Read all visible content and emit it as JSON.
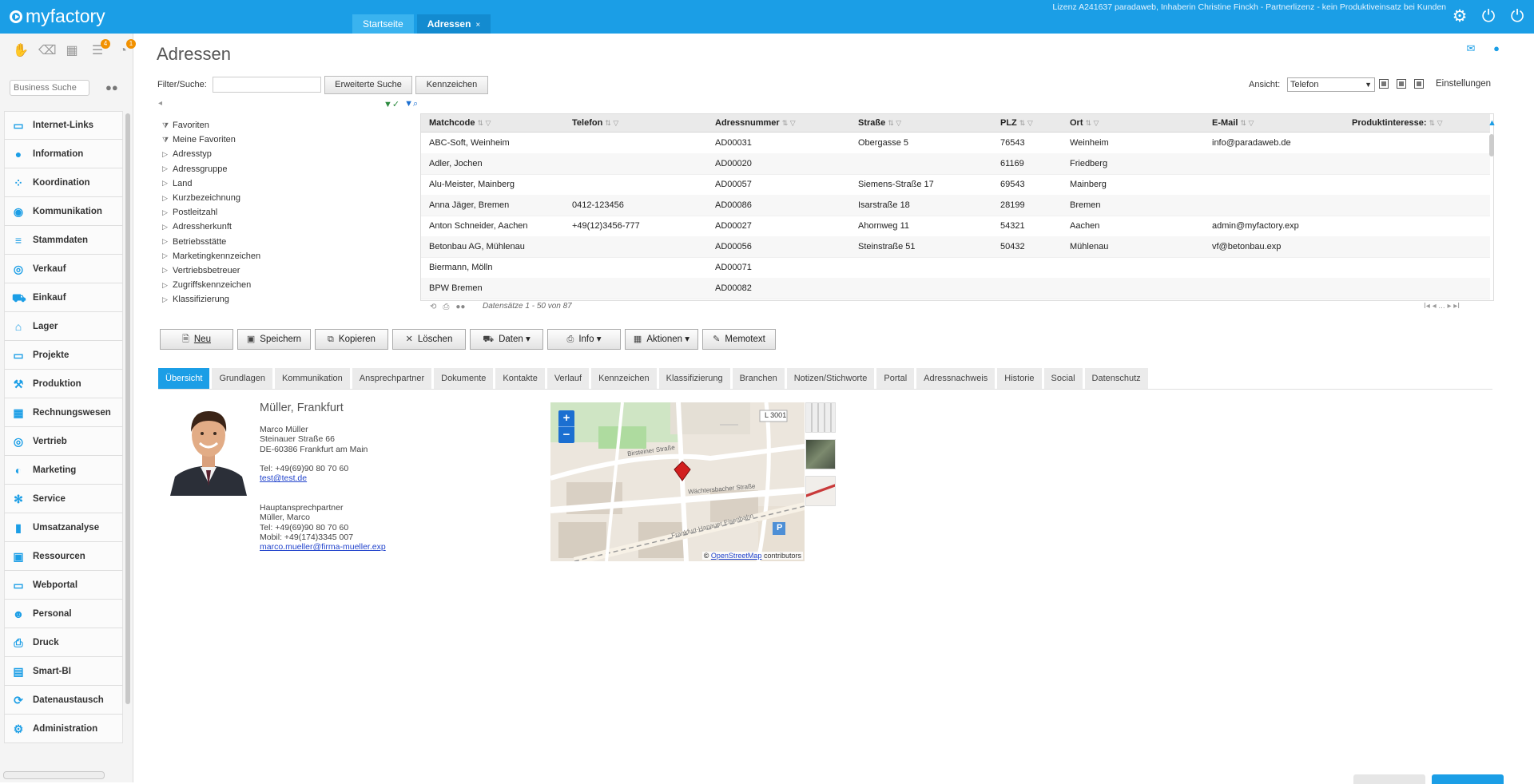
{
  "app": {
    "logo_text": "myfactory",
    "license": "Lizenz A241637 paradaweb, Inhaberin Christine Finckh - Partnerlizenz - kein Produktiveinsatz bei Kunden",
    "tabs": [
      {
        "label": "Startseite"
      },
      {
        "label": "Adressen"
      }
    ],
    "active_tab_close": "×",
    "top_icons": [
      "gear-icon",
      "power-icon",
      "power-alt-icon"
    ]
  },
  "sidebar": {
    "search_placeholder": "Business Suche",
    "modules": [
      {
        "label": "Internet-Links",
        "icon": "globe-icon"
      },
      {
        "label": "Information",
        "icon": "info-icon"
      },
      {
        "label": "Koordination",
        "icon": "network-icon"
      },
      {
        "label": "Kommunikation",
        "icon": "chat-icon"
      },
      {
        "label": "Stammdaten",
        "icon": "database-icon"
      },
      {
        "label": "Verkauf",
        "icon": "coins-icon"
      },
      {
        "label": "Einkauf",
        "icon": "cart-icon"
      },
      {
        "label": "Lager",
        "icon": "warehouse-icon"
      },
      {
        "label": "Projekte",
        "icon": "presentation-icon"
      },
      {
        "label": "Produktion",
        "icon": "factory-icon"
      },
      {
        "label": "Rechnungswesen",
        "icon": "grid-icon"
      },
      {
        "label": "Vertrieb",
        "icon": "target-icon"
      },
      {
        "label": "Marketing",
        "icon": "megaphone-icon"
      },
      {
        "label": "Service",
        "icon": "wrench-icon"
      },
      {
        "label": "Umsatzanalyse",
        "icon": "bar-chart-icon"
      },
      {
        "label": "Ressourcen",
        "icon": "resources-icon"
      },
      {
        "label": "Webportal",
        "icon": "web-icon"
      },
      {
        "label": "Personal",
        "icon": "people-icon"
      },
      {
        "label": "Druck",
        "icon": "printer-icon"
      },
      {
        "label": "Smart-BI",
        "icon": "bi-icon"
      },
      {
        "label": "Datenaustausch",
        "icon": "exchange-icon"
      },
      {
        "label": "Administration",
        "icon": "admin-gear-icon"
      }
    ]
  },
  "main": {
    "title": "Adressen",
    "filter_label": "Filter/Suche:",
    "filter_value": "",
    "btn_extended_search": "Erweiterte Suche",
    "btn_marks": "Kennzeichen",
    "view_label": "Ansicht:",
    "view_value": "Telefon",
    "settings": "Einstellungen",
    "tree": [
      {
        "label": "Favoriten",
        "marker": "filter"
      },
      {
        "label": "Meine Favoriten",
        "marker": "filter"
      },
      {
        "label": "Adresstyp",
        "marker": "tri"
      },
      {
        "label": "Adressgruppe",
        "marker": "tri"
      },
      {
        "label": "Land",
        "marker": "tri"
      },
      {
        "label": "Kurzbezeichnung",
        "marker": "tri"
      },
      {
        "label": "Postleitzahl",
        "marker": "tri"
      },
      {
        "label": "Adressherkunft",
        "marker": "tri"
      },
      {
        "label": "Betriebsstätte",
        "marker": "tri"
      },
      {
        "label": "Marketingkennzeichen",
        "marker": "tri"
      },
      {
        "label": "Vertriebsbetreuer",
        "marker": "tri"
      },
      {
        "label": "Zugriffskennzeichen",
        "marker": "tri"
      },
      {
        "label": "Klassifizierung",
        "marker": "tri"
      }
    ],
    "grid": {
      "columns": [
        "Matchcode",
        "Telefon",
        "Adressnummer",
        "Straße",
        "PLZ",
        "Ort",
        "E-Mail",
        "Produktinteresse:"
      ],
      "rows": [
        [
          "ABC-Soft, Weinheim",
          "",
          "AD00031",
          "Obergasse 5",
          "76543",
          "Weinheim",
          "info@paradaweb.de",
          ""
        ],
        [
          "Adler, Jochen",
          "",
          "AD00020",
          "",
          "61169",
          "Friedberg",
          "",
          ""
        ],
        [
          "Alu-Meister, Mainberg",
          "",
          "AD00057",
          "Siemens-Straße 17",
          "69543",
          "Mainberg",
          "",
          ""
        ],
        [
          "Anna Jäger, Bremen",
          "0412-123456",
          "AD00086",
          "Isarstraße 18",
          "28199",
          "Bremen",
          "",
          ""
        ],
        [
          "Anton Schneider, Aachen",
          "+49(12)3456-777",
          "AD00027",
          "Ahornweg 11",
          "54321",
          "Aachen",
          "admin@myfactory.exp",
          ""
        ],
        [
          "Betonbau AG, Mühlenau",
          "",
          "AD00056",
          "Steinstraße 51",
          "50432",
          "Mühlenau",
          "vf@betonbau.exp",
          ""
        ],
        [
          "Biermann, Mölln",
          "",
          "AD00071",
          "",
          "",
          "",
          "",
          ""
        ],
        [
          "BPW Bremen",
          "",
          "AD00082",
          "",
          "",
          "",
          "",
          ""
        ]
      ],
      "record_count": "Datensätze 1 - 50 von 87",
      "pager": "I◂  ◂  ...  ▸  ▸I"
    },
    "actions": [
      {
        "label": "Neu",
        "icon": "document-icon"
      },
      {
        "label": "Speichern",
        "icon": "save-icon"
      },
      {
        "label": "Kopieren",
        "icon": "copy-icon"
      },
      {
        "label": "Löschen",
        "icon": "delete-icon"
      },
      {
        "label": "Daten ▾",
        "icon": "truck-icon"
      },
      {
        "label": "Info ▾",
        "icon": "print-icon"
      },
      {
        "label": "Aktionen ▾",
        "icon": "calendar-icon"
      },
      {
        "label": "Memotext",
        "icon": "memo-icon"
      }
    ],
    "detail_tabs": [
      "Übersicht",
      "Grundlagen",
      "Kommunikation",
      "Ansprechpartner",
      "Dokumente",
      "Kontakte",
      "Verlauf",
      "Kennzeichen",
      "Klassifizierung",
      "Branchen",
      "Notizen/Stichworte",
      "Portal",
      "Adressnachweis",
      "Historie",
      "Social",
      "Datenschutz"
    ],
    "detail": {
      "name": "Müller, Frankfurt",
      "address": [
        "Marco Müller",
        "Steinauer Straße 66",
        "DE-60386 Frankfurt am Main"
      ],
      "tel": "Tel: +49(69)90 80 70 60",
      "email": "test@test.de",
      "contact": [
        "Hauptansprechpartner",
        "Müller, Marco",
        "Tel: +49(69)90 80 70 60",
        "Mobil: +49(174)3345 007"
      ],
      "contact_email": "marco.mueller@firma-mueller.exp"
    },
    "map": {
      "zoom_in": "+",
      "zoom_out": "−",
      "attribution_prefix": "©",
      "attribution_link": "OpenStreetMap",
      "attribution_suffix": "contributors",
      "labels": [
        "Birsteiner Straße",
        "Wächtersbacher Straße",
        "Frankfurt-Hanauer Eisenbahn",
        "L 3001"
      ]
    }
  },
  "colors": {
    "accent": "#1b9ee6",
    "tab_active": "#138bd0",
    "badge": "#f29100"
  }
}
